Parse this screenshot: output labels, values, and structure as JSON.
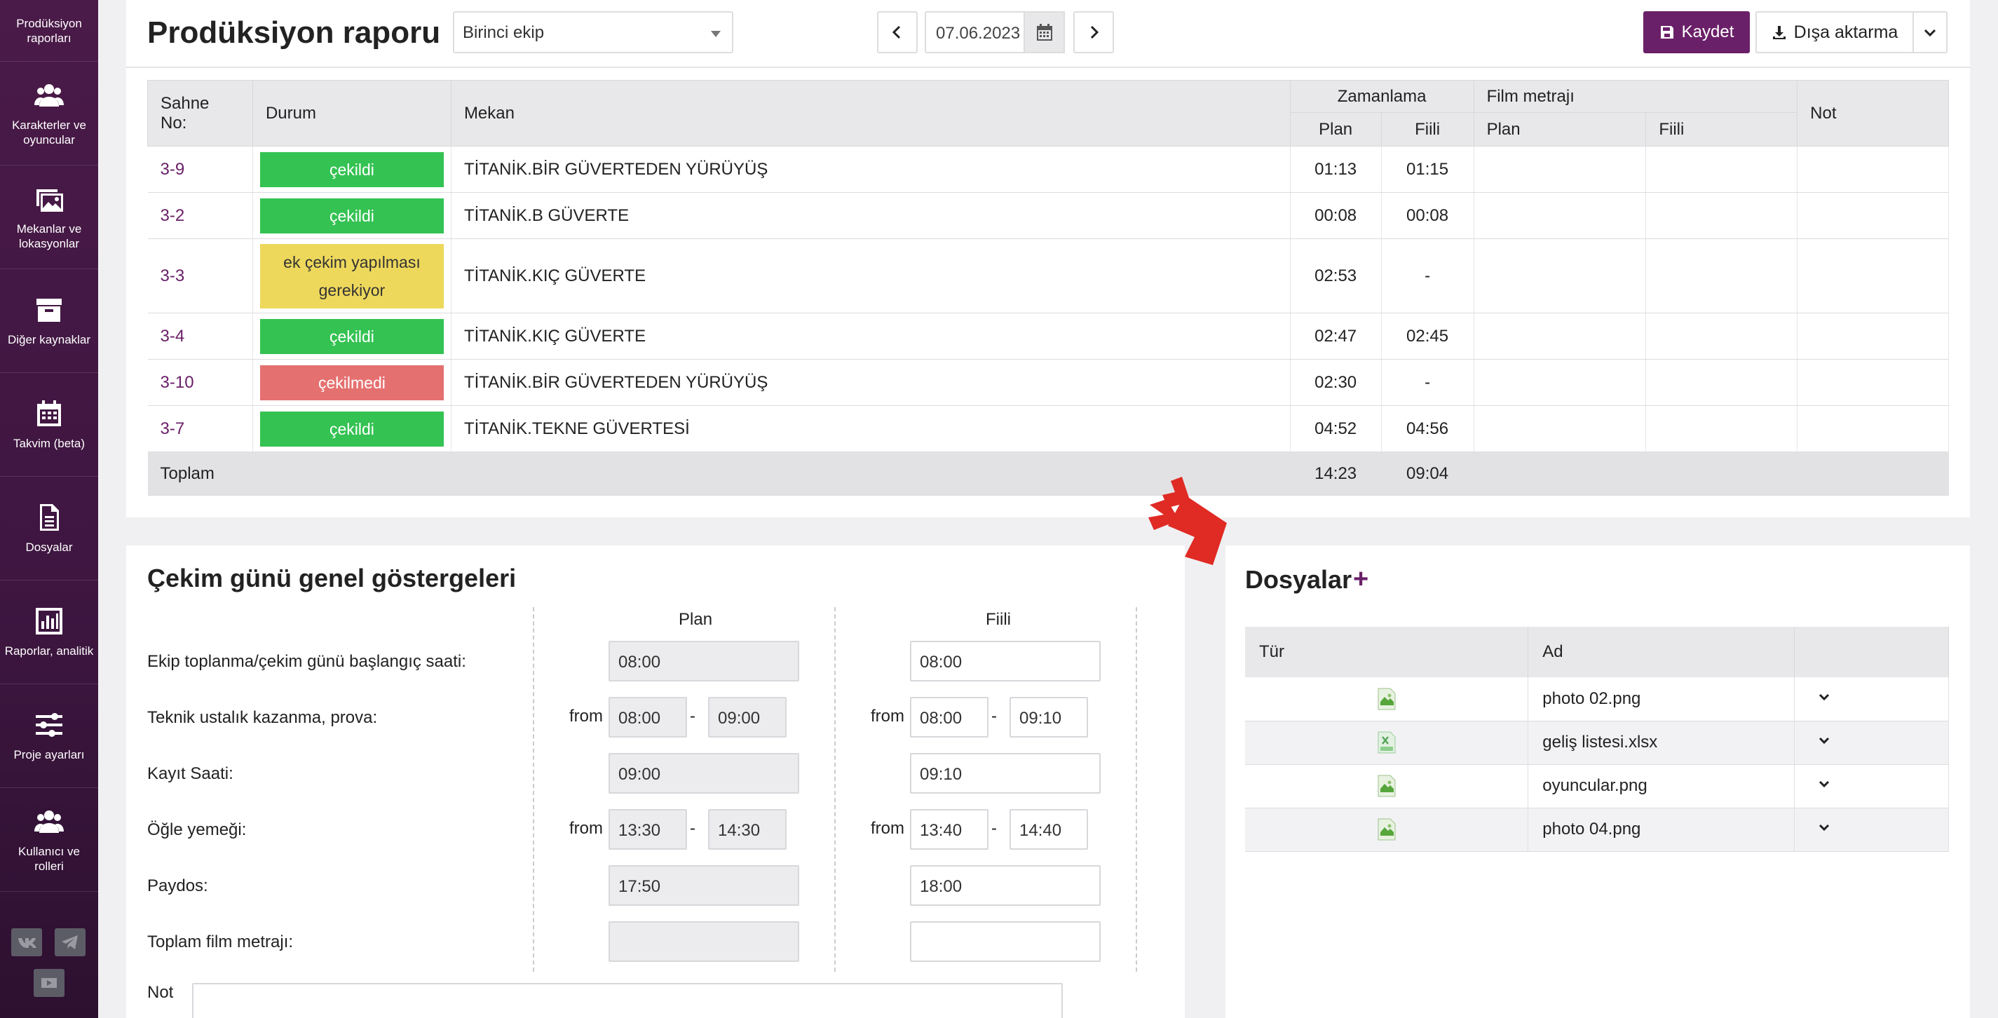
{
  "sidebar": {
    "items": [
      {
        "label": "Prodüksiyon raporları",
        "icon": "report-icon"
      },
      {
        "label": "Karakterler ve oyuncular",
        "icon": "users-icon"
      },
      {
        "label": "Mekanlar ve lokasyonlar",
        "icon": "image-icon"
      },
      {
        "label": "Diğer kaynaklar",
        "icon": "archive-icon"
      },
      {
        "label": "Takvim (beta)",
        "icon": "calendar-icon"
      },
      {
        "label": "Dosyalar",
        "icon": "document-icon"
      },
      {
        "label": "Raporlar, analitik",
        "icon": "bar-chart-icon"
      },
      {
        "label": "Proje ayarları",
        "icon": "sliders-icon"
      },
      {
        "label": "Kullanıcı ve rolleri",
        "icon": "users-icon"
      }
    ],
    "social": [
      "vk-icon",
      "telegram-icon",
      "youtube-icon"
    ]
  },
  "header": {
    "title": "Prodüksiyon raporu",
    "crew_select": "Birinci ekip",
    "date": "07.06.2023",
    "save_label": "Kaydet",
    "export_label": "Dışa aktarma"
  },
  "scenes": {
    "headers": {
      "scene_no": "Sahne No:",
      "status": "Durum",
      "location": "Mekan",
      "timing": "Zamanlama",
      "footage": "Film metrajı",
      "note": "Not",
      "plan": "Plan",
      "actual": "Fiili"
    },
    "rows": [
      {
        "no": "3-9",
        "status": "çekildi",
        "status_color": "green",
        "location": "TİTANİK.BİR GÜVERTEDEN YÜRÜYÜŞ",
        "plan": "01:13",
        "actual": "01:15"
      },
      {
        "no": "3-2",
        "status": "çekildi",
        "status_color": "green",
        "location": "TİTANİK.B GÜVERTE",
        "plan": "00:08",
        "actual": "00:08"
      },
      {
        "no": "3-3",
        "status": "ek çekim yapılması gerekiyor",
        "status_color": "yellow",
        "location": "TİTANİK.KIÇ GÜVERTE",
        "plan": "02:53",
        "actual": "-"
      },
      {
        "no": "3-4",
        "status": "çekildi",
        "status_color": "green",
        "location": "TİTANİK.KIÇ GÜVERTE",
        "plan": "02:47",
        "actual": "02:45"
      },
      {
        "no": "3-10",
        "status": "çekilmedi",
        "status_color": "red",
        "location": "TİTANİK.BİR GÜVERTEDEN YÜRÜYÜŞ",
        "plan": "02:30",
        "actual": "-"
      },
      {
        "no": "3-7",
        "status": "çekildi",
        "status_color": "green",
        "location": "TİTANİK.TEKNE GÜVERTESİ",
        "plan": "04:52",
        "actual": "04:56"
      }
    ],
    "total": {
      "label": "Toplam",
      "plan": "14:23",
      "actual": "09:04"
    }
  },
  "indicators": {
    "title": "Çekim günü genel göstergeleri",
    "plan_label": "Plan",
    "actual_label": "Fiili",
    "from_label": "from",
    "sep": "-",
    "rows": {
      "crew_call": {
        "label": "Ekip toplanma/çekim günü başlangıç saati:",
        "plan": "08:00",
        "actual": "08:00"
      },
      "tech": {
        "label": "Teknik ustalık kazanma, prova:",
        "plan_from": "08:00",
        "plan_to": "09:00",
        "actual_from": "08:00",
        "actual_to": "09:10"
      },
      "record": {
        "label": "Kayıt Saati:",
        "plan": "09:00",
        "actual": "09:10"
      },
      "lunch": {
        "label": "Öğle yemeği:",
        "plan_from": "13:30",
        "plan_to": "14:30",
        "actual_from": "13:40",
        "actual_to": "14:40"
      },
      "wrap": {
        "label": "Paydos:",
        "plan": "17:50",
        "actual": "18:00"
      },
      "footage": {
        "label": "Toplam film metrajı:",
        "plan": "",
        "actual": ""
      }
    },
    "note_label": "Not"
  },
  "files": {
    "title": "Dosyalar",
    "plus": "+",
    "headers": {
      "type": "Tür",
      "name": "Ad"
    },
    "rows": [
      {
        "name": "photo 02.png",
        "type_icon": "png-file-icon"
      },
      {
        "name": "geliş listesi.xlsx",
        "type_icon": "xlsx-file-icon"
      },
      {
        "name": "oyuncular.png",
        "type_icon": "png-file-icon"
      },
      {
        "name": "photo 04.png",
        "type_icon": "png-file-icon"
      }
    ]
  },
  "colors": {
    "brand": "#6a2068",
    "sidebar": "#4a1a48",
    "green": "#34c252",
    "red": "#e57070",
    "yellow": "#eed85c",
    "decor_arrow": "#e02a24"
  }
}
